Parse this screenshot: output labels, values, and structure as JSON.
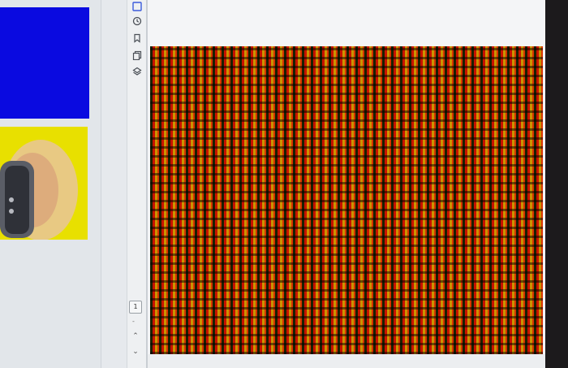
{
  "sidebar": {
    "thumbnails": [
      {
        "color": "#0a0ae0"
      },
      {
        "color": "#e8e000"
      }
    ]
  },
  "rail": {
    "icons": [
      "pages-icon",
      "history-icon",
      "bookmark-icon",
      "copy-icon",
      "layers-icon"
    ]
  },
  "pagination": {
    "current_page": "1",
    "separator": "-",
    "up_arrow": "⌃",
    "down_arrow": "⌄"
  },
  "viewer": {
    "pattern_colors": [
      "#1c3008",
      "#d41a06",
      "#d8d600",
      "#e64c00"
    ]
  },
  "colors": {
    "accent": "#3b5bdb",
    "bezel": "#1c1a1c"
  }
}
